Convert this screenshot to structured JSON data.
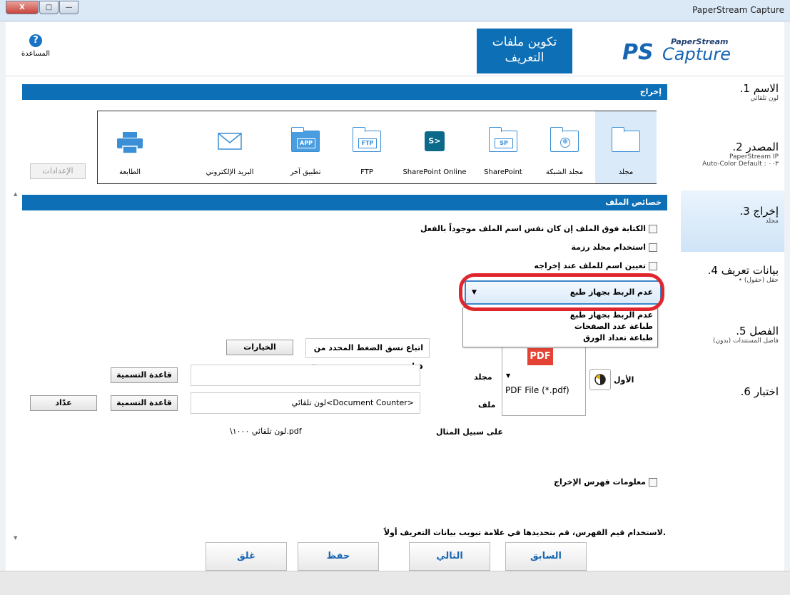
{
  "window": {
    "title": "PaperStream Capture",
    "close_label": "X",
    "max_label": "□",
    "min_label": "—"
  },
  "header": {
    "help_label": "المساعدة",
    "help_icon": "?",
    "page_title": "تكوين ملفات التعريف",
    "logo_ps": "PaperStream",
    "logo_capture": "Capture",
    "logo_mark": "PS"
  },
  "steps": [
    {
      "num": ".1",
      "title": "الاسم",
      "sub": "لون تلقائي"
    },
    {
      "num": ".2",
      "title": "المصدر",
      "sub": "PaperStream IP",
      "sub2": "Auto-Color Default : ٠٠٣"
    },
    {
      "num": ".3",
      "title": "إخراج",
      "sub": "مجلد"
    },
    {
      "num": ".4",
      "title": "بيانات تعريف",
      "sub": "• حقل (حقول)"
    },
    {
      "num": ".5",
      "title": "الفصل",
      "sub": "فاصل المستندات (بدون)"
    },
    {
      "num": ".6",
      "title": "اختبار",
      "sub": ""
    }
  ],
  "output": {
    "section_title": "إخراج",
    "settings_button": "الإعدادات",
    "destinations": [
      {
        "label": "مجلد",
        "icon": "folder-icon"
      },
      {
        "label": "مجلد الشبكة",
        "icon": "network-folder-icon"
      },
      {
        "label": "SharePoint",
        "icon": "sharepoint-icon",
        "tag": "SP"
      },
      {
        "label": "SharePoint Online",
        "icon": "sharepoint-online-icon",
        "tag": "S>"
      },
      {
        "label": "FTP",
        "icon": "ftp-icon",
        "tag": "FTP"
      },
      {
        "label": "تطبيق آخر",
        "icon": "app-icon",
        "tag": "APP"
      },
      {
        "label": "البريد الإلكتروني",
        "icon": "mail-icon"
      },
      {
        "label": "الطابعة",
        "icon": "printer-icon"
      }
    ]
  },
  "file_properties": {
    "section_title": "خصائص الملف",
    "overwrite_checkbox": "الكتابة فوق الملف إن كان نفس اسم الملف موجوداً بالفعل",
    "batch_folder_checkbox": "استخدام مجلد رزمة",
    "name_on_output_checkbox": "تعيين اسم للملف عند إخراجه",
    "imprinter_combo": "عدم الربط بجهاز طبع",
    "imprinter_options": [
      "عدم الربط بجهاز طبع",
      "طباعة عدد الصفحات",
      "طباعة تعداد الورق"
    ],
    "first_label": "الأول",
    "file_format": "PDF File (*.pdf)",
    "pdf_badge": "PDF",
    "compression_value": "اتباع نسق الضغط المحدد من قبل",
    "options_button": "الخيارات",
    "folder_label": "مجلد",
    "folder_value": "",
    "naming_rule_button": "قاعدة التسمية",
    "file_label": "ملف",
    "file_value": "لون تلقائي<Document Counter>",
    "naming_rule_button_2": "قاعدة التسمية",
    "counter_button": "عدّاد",
    "example_label": "على سبيل المثال",
    "example_value": "\\لون تلقائي ١٠٠٠.pdf",
    "index_checkbox": "معلومات فهرس الإخراج",
    "index_note": "لاستخدام قيم الفهرس، قم بتحديدها في علامة تبويب بيانات التعريف أولاً."
  },
  "footer": {
    "back": "السابق",
    "next": "التالي",
    "save": "حفظ",
    "close": "غلق"
  },
  "colors": {
    "accent": "#0d6fb5",
    "highlight": "#e0262d"
  }
}
